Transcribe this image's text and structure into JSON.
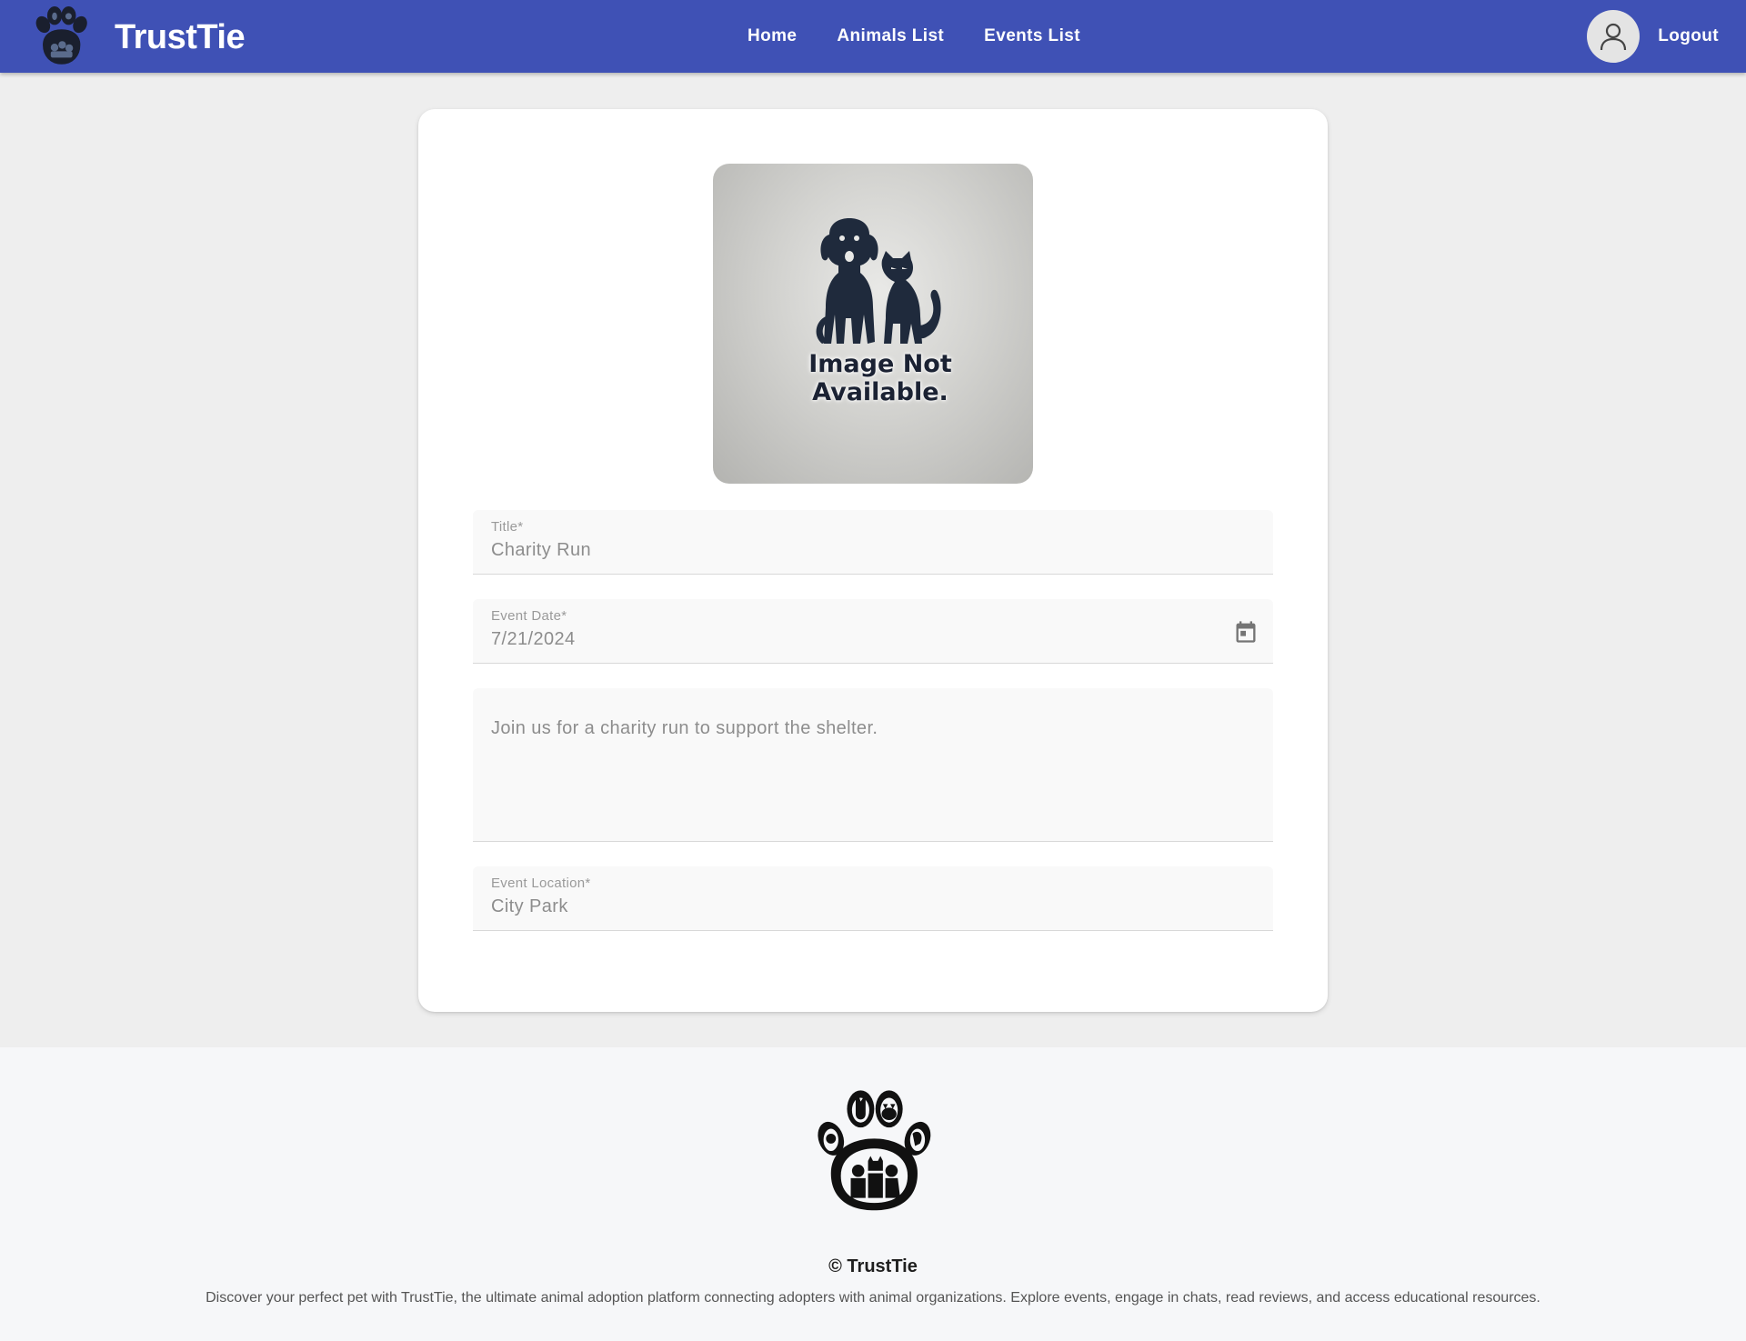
{
  "header": {
    "brand_name": "TrustTie",
    "nav": [
      "Home",
      "Animals List",
      "Events List"
    ],
    "logout_label": "Logout",
    "bg_color": "#3f51b5"
  },
  "event_image": {
    "caption_line1": "Image Not",
    "caption_line2": "Available."
  },
  "form": {
    "title": {
      "label": "Title*",
      "value": "Charity Run"
    },
    "event_date": {
      "label": "Event Date*",
      "value": "7/21/2024",
      "icon": "calendar-icon"
    },
    "description": {
      "value": "Join us for a charity run to support the shelter."
    },
    "location": {
      "label": "Event Location*",
      "value": "City Park"
    }
  },
  "footer": {
    "copyright": "© TrustTie",
    "description": "Discover your perfect pet with TrustTie, the ultimate animal adoption platform connecting adopters with animal organizations. Explore events, engage in chats, read reviews, and access educational resources."
  }
}
